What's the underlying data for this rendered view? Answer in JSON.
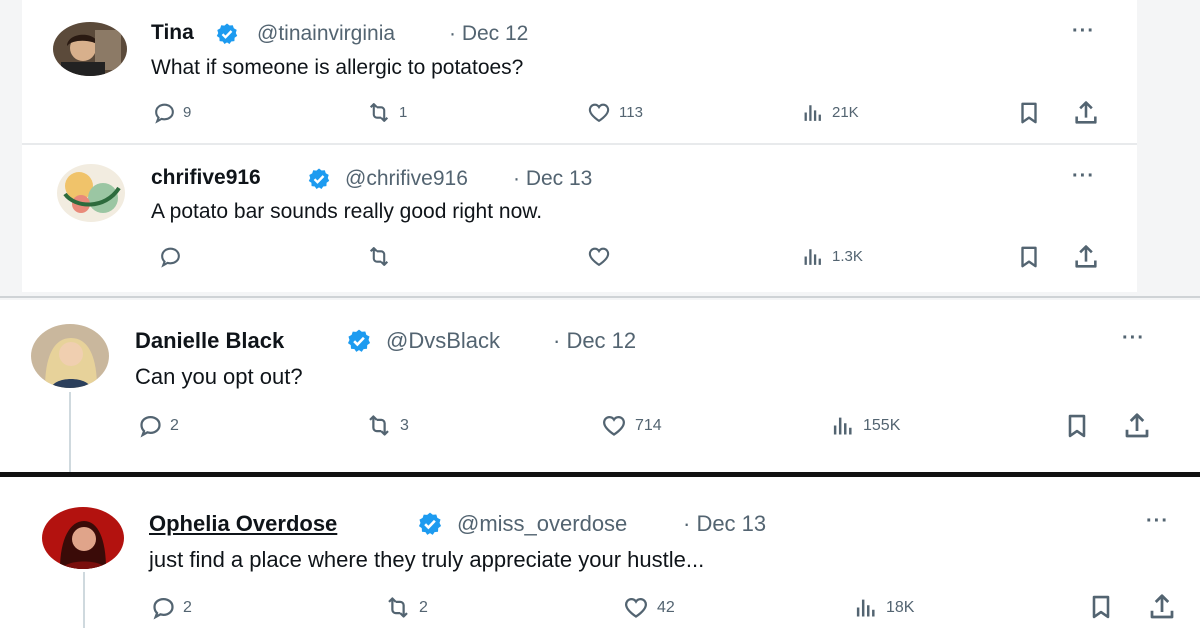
{
  "tweets": [
    {
      "name": "Tina",
      "handle": "@tinainvirginia",
      "date": "· Dec 12",
      "text": "What if someone is allergic to potatoes?",
      "replies": "9",
      "reposts": "1",
      "likes": "113",
      "views": "21K"
    },
    {
      "name": "chrifive916",
      "handle": "@chrifive916",
      "date": "· Dec 13",
      "text": "A potato bar sounds really good right now.",
      "replies": "",
      "reposts": "",
      "likes": "",
      "views": "1.3K"
    },
    {
      "name": "Danielle Black",
      "handle": "@DvsBlack",
      "date": "· Dec 12",
      "text": "Can you opt out?",
      "replies": "2",
      "reposts": "3",
      "likes": "714",
      "views": "155K"
    },
    {
      "name": "Ophelia Overdose",
      "handle": "@miss_overdose",
      "date": "· Dec 13",
      "text": "just find a place where they truly appreciate your hustle...",
      "replies": "2",
      "reposts": "2",
      "likes": "42",
      "views": "18K"
    }
  ],
  "more_label": "···",
  "colors": {
    "verified": "#1d9bf0",
    "muted": "#536471"
  },
  "icons": [
    "reply-icon",
    "repost-icon",
    "like-icon",
    "views-icon",
    "bookmark-icon",
    "share-icon",
    "verified-badge-icon",
    "more-icon"
  ]
}
